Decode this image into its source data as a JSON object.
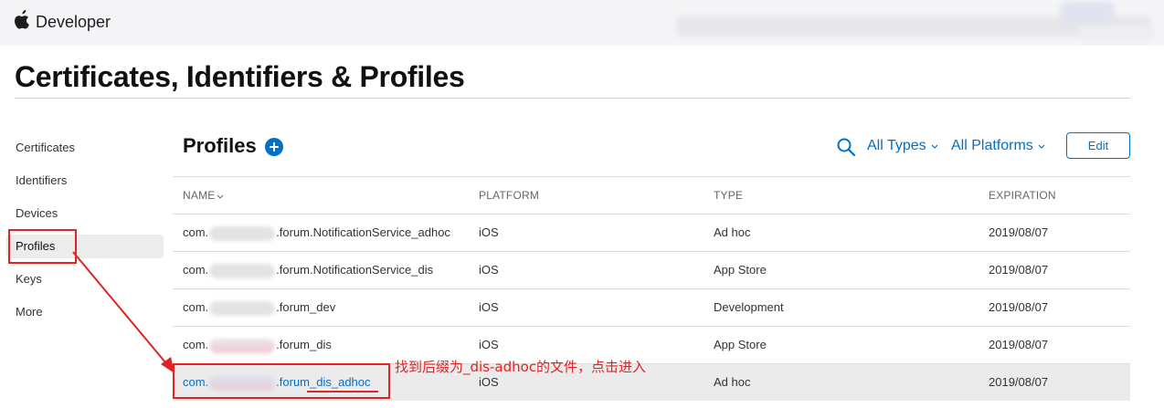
{
  "brand": {
    "name": "Developer"
  },
  "page": {
    "title": "Certificates, Identifiers & Profiles"
  },
  "sidebar": {
    "items": [
      {
        "label": "Certificates"
      },
      {
        "label": "Identifiers"
      },
      {
        "label": "Devices"
      },
      {
        "label": "Profiles",
        "active": true
      },
      {
        "label": "Keys"
      },
      {
        "label": "More"
      }
    ]
  },
  "section": {
    "title": "Profiles",
    "filters": {
      "types": "All Types",
      "platforms": "All Platforms"
    },
    "edit_label": "Edit"
  },
  "table": {
    "columns": {
      "name": "NAME",
      "platform": "PLATFORM",
      "type": "TYPE",
      "expiration": "EXPIRATION"
    },
    "rows": [
      {
        "name_prefix": "com.",
        "name_suffix": ".forum.NotificationService_adhoc",
        "platform": "iOS",
        "type": "Ad hoc",
        "expiration": "2019/08/07"
      },
      {
        "name_prefix": "com.",
        "name_suffix": ".forum.NotificationService_dis",
        "platform": "iOS",
        "type": "App Store",
        "expiration": "2019/08/07"
      },
      {
        "name_prefix": "com.",
        "name_suffix": ".forum_dev",
        "platform": "iOS",
        "type": "Development",
        "expiration": "2019/08/07"
      },
      {
        "name_prefix": "com.",
        "name_suffix": ".forum_dis",
        "platform": "iOS",
        "type": "App Store",
        "expiration": "2019/08/07"
      },
      {
        "name_prefix": "com.",
        "name_suffix": ".forum_dis_adhoc",
        "platform": "iOS",
        "type": "Ad hoc",
        "expiration": "2019/08/07"
      }
    ]
  },
  "annotation": {
    "text": "找到后缀为_dis-adhoc的文件，点击进入",
    "color": "#e02424"
  },
  "colors": {
    "accent": "#0070c9",
    "topbar": "#f5f5f7",
    "highlight_row": "#ebebeb"
  }
}
